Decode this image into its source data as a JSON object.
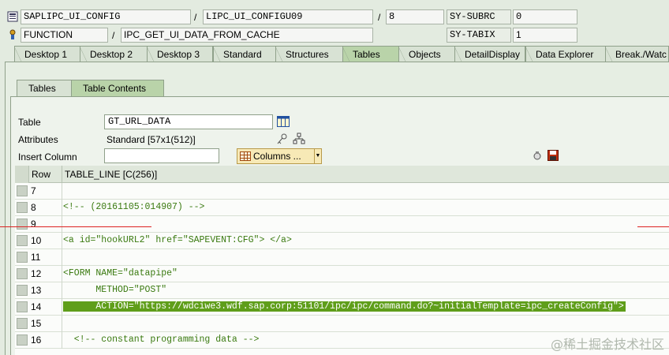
{
  "header": {
    "row1": {
      "field1": "SAPLIPC_UI_CONFIG",
      "field2": "LIPC_UI_CONFIGU09",
      "field3": "8",
      "label": "SY-SUBRC",
      "value": "0"
    },
    "row2": {
      "field1": "FUNCTION",
      "field2": "IPC_GET_UI_DATA_FROM_CACHE",
      "label": "SY-TABIX",
      "value": "1"
    },
    "slash": "/"
  },
  "tabs": [
    {
      "label": "Desktop 1"
    },
    {
      "label": "Desktop 2"
    },
    {
      "label": "Desktop 3"
    },
    {
      "label": "Standard"
    },
    {
      "label": "Structures"
    },
    {
      "label": "Tables",
      "active": true
    },
    {
      "label": "Objects"
    },
    {
      "label": "DetailDisplay"
    },
    {
      "label": "Data Explorer"
    },
    {
      "label": "Break./Watc"
    }
  ],
  "subtabs": [
    {
      "label": "Tables"
    },
    {
      "label": "Table Contents",
      "active": true
    }
  ],
  "form": {
    "table_label": "Table",
    "table_value": "GT_URL_DATA",
    "attributes_label": "Attributes",
    "attributes_value": "Standard [57x1(512)]",
    "insert_column_label": "Insert Column",
    "insert_column_value": "",
    "columns_button": "Columns ..."
  },
  "table": {
    "col_row": "Row",
    "col_line": "TABLE_LINE [C(256)]",
    "rows": [
      {
        "num": "7",
        "text": ""
      },
      {
        "num": "8",
        "text": "<!-- (20161105:014907) -->"
      },
      {
        "num": "9",
        "text": ""
      },
      {
        "num": "10",
        "text": "<a id=\"hookURL2\" href=\"SAPEVENT:CFG\"> </a>"
      },
      {
        "num": "11",
        "text": ""
      },
      {
        "num": "12",
        "text": "<FORM NAME=\"datapipe\""
      },
      {
        "num": "13",
        "text": "      METHOD=\"POST\""
      },
      {
        "num": "14",
        "text": "      ACTION=\"https://wdciwe3.wdf.sap.corp:51101/ipc/ipc/command.do?~initialTemplate=ipc_createConfig\">",
        "highlight": true
      },
      {
        "num": "15",
        "text": ""
      },
      {
        "num": "16",
        "text": "  <!-- constant programming data -->"
      }
    ]
  },
  "watermark": "@稀土掘金技术社区",
  "colors": {
    "background": "#e3ebe0",
    "tab_active": "#b9d3a9",
    "code_text": "#3a7a10",
    "highlight": "#5f9e1a"
  }
}
